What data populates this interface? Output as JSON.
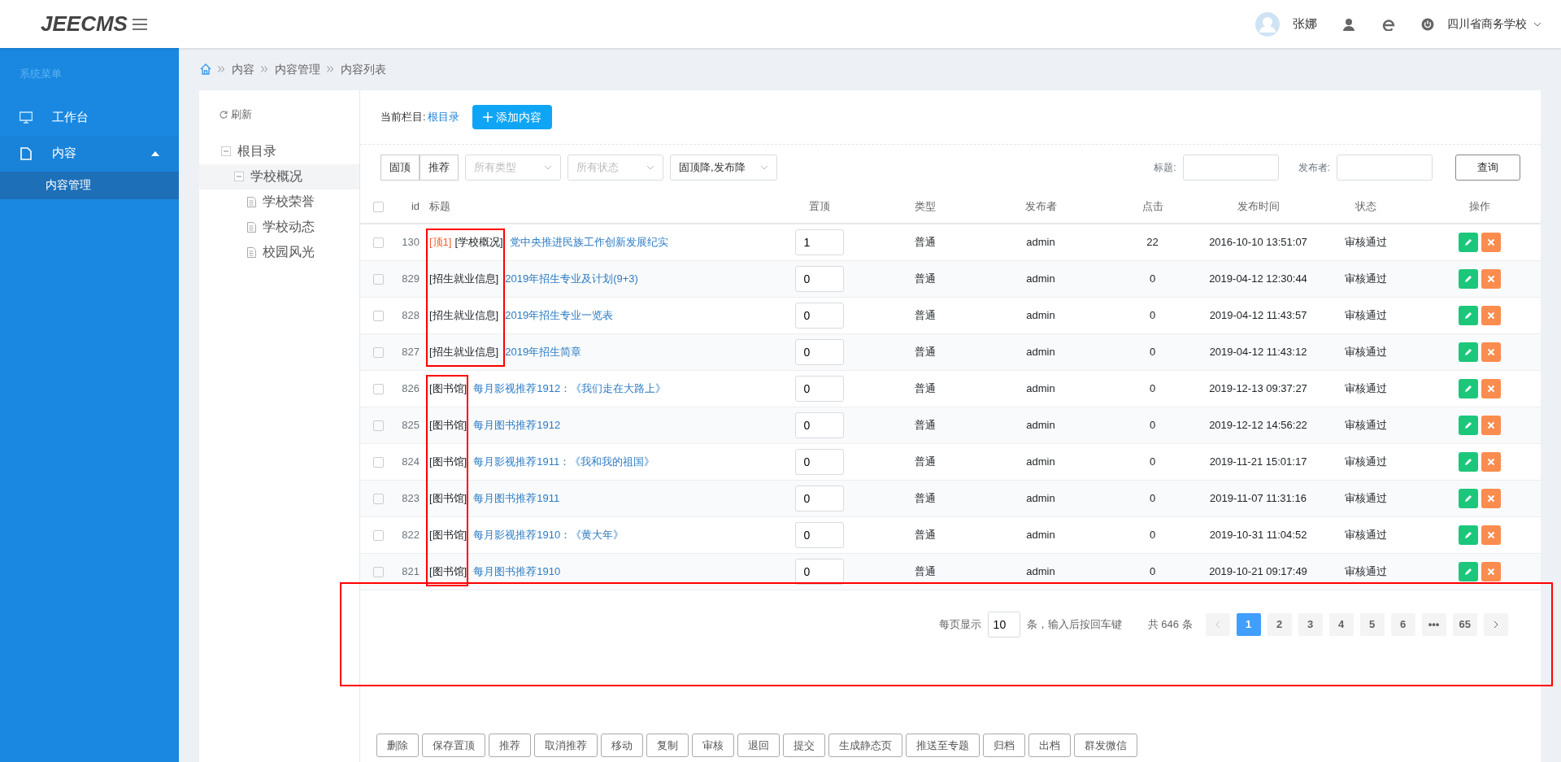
{
  "header": {
    "logo": "JEECMS",
    "user_name": "张娜",
    "site": "四川省商务学校"
  },
  "sidebar": {
    "title": "系统菜单",
    "items": [
      {
        "kind": "monitor",
        "label": "工作台"
      },
      {
        "kind": "document",
        "label": "内容",
        "expanded": true,
        "children": [
          {
            "label": "内容管理",
            "selected": true
          }
        ]
      }
    ]
  },
  "breadcrumb": [
    "内容",
    "内容管理",
    "内容列表"
  ],
  "tree": {
    "refresh": "刷新",
    "nodes": [
      {
        "label": "根目录",
        "selected": false,
        "children": [
          {
            "label": "学校概况",
            "selected": true,
            "children": [
              {
                "label": "学校荣誉",
                "selected": false
              },
              {
                "label": "学校动态",
                "selected": false
              },
              {
                "label": "校园风光",
                "selected": false
              }
            ]
          }
        ]
      }
    ]
  },
  "current": {
    "label": "当前栏目:",
    "value": "根目录",
    "add_button": "添加内容"
  },
  "filters": {
    "toggles": [
      "固顶",
      "推荐"
    ],
    "selects": [
      {
        "placeholder": "所有类型"
      },
      {
        "placeholder": "所有状态"
      },
      {
        "value": "固顶降,发布降"
      }
    ],
    "title_label": "标题:",
    "publisher_label": "发布者:",
    "query_button": "查询"
  },
  "table": {
    "columns": [
      "id",
      "标题",
      "置顶",
      "类型",
      "发布者",
      "点击",
      "发布时间",
      "状态",
      "操作"
    ],
    "select_all_checked": false,
    "row_groups": [
      {
        "framed": true,
        "rows": [
          {
            "checked": false,
            "id": "130",
            "top_tag": "[顶1]",
            "category": "[学校概况]",
            "title": "党中央推进民族工作创新发展纪实",
            "pin": "1",
            "type": "普通",
            "publisher": "admin",
            "clicks": "22",
            "time": "2016-10-10 13:51:07",
            "status": "审核通过"
          },
          {
            "checked": false,
            "id": "829",
            "category": "[招生就业信息]",
            "title": "2019年招生专业及计划(9+3)",
            "pin": "0",
            "type": "普通",
            "publisher": "admin",
            "clicks": "0",
            "time": "2019-04-12 12:30:44",
            "status": "审核通过"
          },
          {
            "checked": false,
            "id": "828",
            "category": "[招生就业信息]",
            "title": "2019年招生专业一览表",
            "pin": "0",
            "type": "普通",
            "publisher": "admin",
            "clicks": "0",
            "time": "2019-04-12 11:43:57",
            "status": "审核通过"
          },
          {
            "checked": false,
            "id": "827",
            "category": "[招生就业信息]",
            "title": "2019年招生简章",
            "pin": "0",
            "type": "普通",
            "publisher": "admin",
            "clicks": "0",
            "time": "2019-04-12 11:43:12",
            "status": "审核通过"
          }
        ]
      },
      {
        "framed": true,
        "rows": [
          {
            "checked": false,
            "id": "826",
            "category": "[图书馆]",
            "title": "每月影视推荐1912：《我们走在大路上》",
            "pin": "0",
            "type": "普通",
            "publisher": "admin",
            "clicks": "0",
            "time": "2019-12-13 09:37:27",
            "status": "审核通过"
          },
          {
            "checked": false,
            "id": "825",
            "category": "[图书馆]",
            "title": "每月图书推荐1912",
            "pin": "0",
            "type": "普通",
            "publisher": "admin",
            "clicks": "0",
            "time": "2019-12-12 14:56:22",
            "status": "审核通过"
          },
          {
            "checked": false,
            "id": "824",
            "category": "[图书馆]",
            "title": "每月影视推荐1911：《我和我的祖国》",
            "pin": "0",
            "type": "普通",
            "publisher": "admin",
            "clicks": "0",
            "time": "2019-11-21 15:01:17",
            "status": "审核通过"
          },
          {
            "checked": false,
            "id": "823",
            "category": "[图书馆]",
            "title": "每月图书推荐1911",
            "pin": "0",
            "type": "普通",
            "publisher": "admin",
            "clicks": "0",
            "time": "2019-11-07 11:31:16",
            "status": "审核通过"
          },
          {
            "checked": false,
            "id": "822",
            "category": "[图书馆]",
            "title": "每月影视推荐1910：《黄大年》",
            "pin": "0",
            "type": "普通",
            "publisher": "admin",
            "clicks": "0",
            "time": "2019-10-31 11:04:52",
            "status": "审核通过"
          },
          {
            "checked": false,
            "id": "821",
            "category": "[图书馆]",
            "title": "每月图书推荐1910",
            "pin": "0",
            "type": "普通",
            "publisher": "admin",
            "clicks": "0",
            "time": "2019-10-21 09:17:49",
            "status": "审核通过"
          }
        ]
      }
    ]
  },
  "pagination": {
    "per_page_label": "每页显示",
    "per_page": "10",
    "hint": "条，输入后按回车键",
    "total": "共 646 条",
    "prev_disabled": true,
    "pages": [
      {
        "label": "1",
        "selected": true
      },
      {
        "label": "2",
        "selected": false
      },
      {
        "label": "3",
        "selected": false
      },
      {
        "label": "4",
        "selected": false
      },
      {
        "label": "5",
        "selected": false
      },
      {
        "label": "6",
        "selected": false
      },
      {
        "label": "•••",
        "selected": false
      },
      {
        "label": "65",
        "selected": false
      }
    ],
    "framed": true
  },
  "actions": [
    "删除",
    "保存置顶",
    "推荐",
    "取消推荐",
    "移动",
    "复制",
    "审核",
    "退回",
    "提交",
    "生成静态页",
    "推送至专题",
    "归档",
    "出档",
    "群发微信"
  ]
}
